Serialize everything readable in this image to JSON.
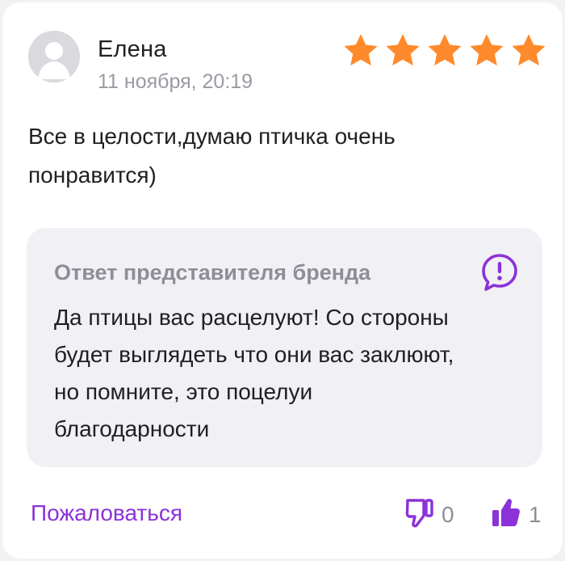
{
  "review": {
    "author": "Елена",
    "date": "11 ноября, 20:19",
    "rating": 5,
    "rating_max": 5,
    "text_line1": "Все в целости,думаю птичка очень",
    "text_line2": "понравится)"
  },
  "brand_reply": {
    "title": "Ответ представителя бренда",
    "line1": "Да птицы вас расцелуют! Со стороны",
    "line2": "будет выглядеть что они вас заклюют,",
    "line3": "но помните, это поцелуи",
    "line4": "благодарности",
    "icon": "exclamation-bubble-icon"
  },
  "actions": {
    "complain_label": "Пожаловаться",
    "dislike_count": "0",
    "like_count": "1",
    "dislike_icon": "thumbs-down-outline-icon",
    "like_icon": "thumbs-up-filled-icon"
  },
  "colors": {
    "star": "#ff8a2b",
    "accent_purple": "#8b32d8",
    "muted_text": "#9a9aa3",
    "reply_background": "#f1f1f5",
    "avatar_gray": "#d9d9de"
  }
}
